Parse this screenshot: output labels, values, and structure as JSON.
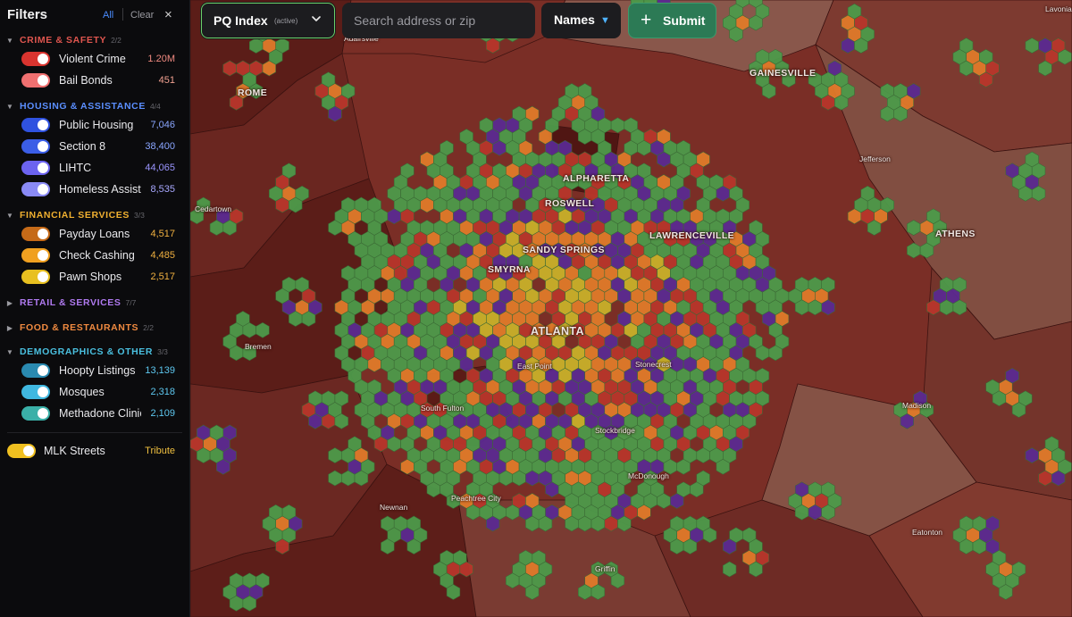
{
  "sidebar": {
    "title": "Filters",
    "all_label": "All",
    "clear_label": "Clear",
    "close_glyph": "×",
    "groups": [
      {
        "name": "CRIME & SAFETY",
        "count": "2/2",
        "color": "#e0564f",
        "chevron": "▼",
        "items": [
          {
            "label": "Violent Crime",
            "count": "1.20M",
            "toggle_color": "#d9342f",
            "count_color": "#f08a80"
          },
          {
            "label": "Bail Bonds",
            "count": "451",
            "toggle_color": "#f07070",
            "count_color": "#f0a090"
          }
        ]
      },
      {
        "name": "HOUSING & ASSISTANCE",
        "count": "4/4",
        "color": "#5b8fff",
        "chevron": "▼",
        "items": [
          {
            "label": "Public Housing",
            "count": "7,046",
            "toggle_color": "#2f52e0",
            "count_color": "#8aa6ff"
          },
          {
            "label": "Section 8",
            "count": "38,400",
            "toggle_color": "#3b5ee6",
            "count_color": "#8aa6ff"
          },
          {
            "label": "LIHTC",
            "count": "44,065",
            "toggle_color": "#6c63f0",
            "count_color": "#9b95ff"
          },
          {
            "label": "Homeless Assistance",
            "count": "8,535",
            "toggle_color": "#8a8af5",
            "count_color": "#a8a8ff"
          }
        ]
      },
      {
        "name": "FINANCIAL SERVICES",
        "count": "3/3",
        "color": "#f0b030",
        "chevron": "▼",
        "items": [
          {
            "label": "Payday Loans",
            "count": "4,517",
            "toggle_color": "#c56a18",
            "count_color": "#f0b040"
          },
          {
            "label": "Check Cashing",
            "count": "4,485",
            "toggle_color": "#f0a020",
            "count_color": "#f0b040"
          },
          {
            "label": "Pawn Shops",
            "count": "2,517",
            "toggle_color": "#e8c020",
            "count_color": "#f0b040"
          }
        ]
      },
      {
        "name": "RETAIL & SERVICES",
        "count": "7/7",
        "color": "#b07af0",
        "chevron": "▶",
        "items": []
      },
      {
        "name": "FOOD & RESTAURANTS",
        "count": "2/2",
        "color": "#f08a40",
        "chevron": "▶",
        "items": []
      },
      {
        "name": "DEMOGRAPHICS & OTHER",
        "count": "3/3",
        "color": "#4ac0e0",
        "chevron": "▼",
        "items": [
          {
            "label": "Hoopty Listings",
            "count": "13,139",
            "toggle_color": "#2a8ab0",
            "count_color": "#5ec8f0"
          },
          {
            "label": "Mosques",
            "count": "2,318",
            "toggle_color": "#40b8e0",
            "count_color": "#5ec8f0"
          },
          {
            "label": "Methadone Clinics",
            "count": "2,109",
            "toggle_color": "#3ab0a8",
            "count_color": "#5ec8f0"
          }
        ]
      }
    ],
    "mlk": {
      "label": "MLK Streets",
      "tag": "Tribute",
      "toggle_color": "#f0c020",
      "tag_color": "#f0c040"
    }
  },
  "toolbar": {
    "pq_label": "PQ Index",
    "pq_status": "(active)",
    "search_placeholder": "Search address or zip",
    "names_label": "Names",
    "names_glyph": "▼",
    "submit_glyph": "+",
    "submit_label": "Submit"
  },
  "map": {
    "cities": [
      {
        "name": "Adairsville",
        "size": "sm"
      },
      {
        "name": "ROME",
        "size": "med"
      },
      {
        "name": "GAINESVILLE",
        "size": "med"
      },
      {
        "name": "Lavonia",
        "size": "sm"
      },
      {
        "name": "Jefferson",
        "size": "sm"
      },
      {
        "name": "ALPHARETTA",
        "size": "med"
      },
      {
        "name": "ROSWELL",
        "size": "med"
      },
      {
        "name": "Cedartown",
        "size": "sm"
      },
      {
        "name": "LAWRENCEVILLE",
        "size": "med"
      },
      {
        "name": "ATHENS",
        "size": "med"
      },
      {
        "name": "SANDY SPRINGS",
        "size": "med"
      },
      {
        "name": "SMYRNA",
        "size": "med"
      },
      {
        "name": "ATLANTA",
        "size": "big"
      },
      {
        "name": "Bremen",
        "size": "sm"
      },
      {
        "name": "East Point",
        "size": "sm"
      },
      {
        "name": "Stonecrest",
        "size": "sm"
      },
      {
        "name": "South Fulton",
        "size": "sm"
      },
      {
        "name": "Madison",
        "size": "sm"
      },
      {
        "name": "Stockbridge",
        "size": "sm"
      },
      {
        "name": "McDonough",
        "size": "sm"
      },
      {
        "name": "Newnan",
        "size": "sm"
      },
      {
        "name": "Peachtree City",
        "size": "sm"
      },
      {
        "name": "Eatonton",
        "size": "sm"
      },
      {
        "name": "Griffin",
        "size": "sm"
      }
    ],
    "palette": {
      "county_dark": "#5a1d18",
      "county_mid": "#7a2e26",
      "county_light": "#8a5a4e",
      "hex_green": "#4d9a4a",
      "hex_purple": "#5b2a91",
      "hex_red": "#b8362b",
      "hex_orange": "#e07a2a",
      "hex_yellow": "#c9b02a"
    }
  }
}
